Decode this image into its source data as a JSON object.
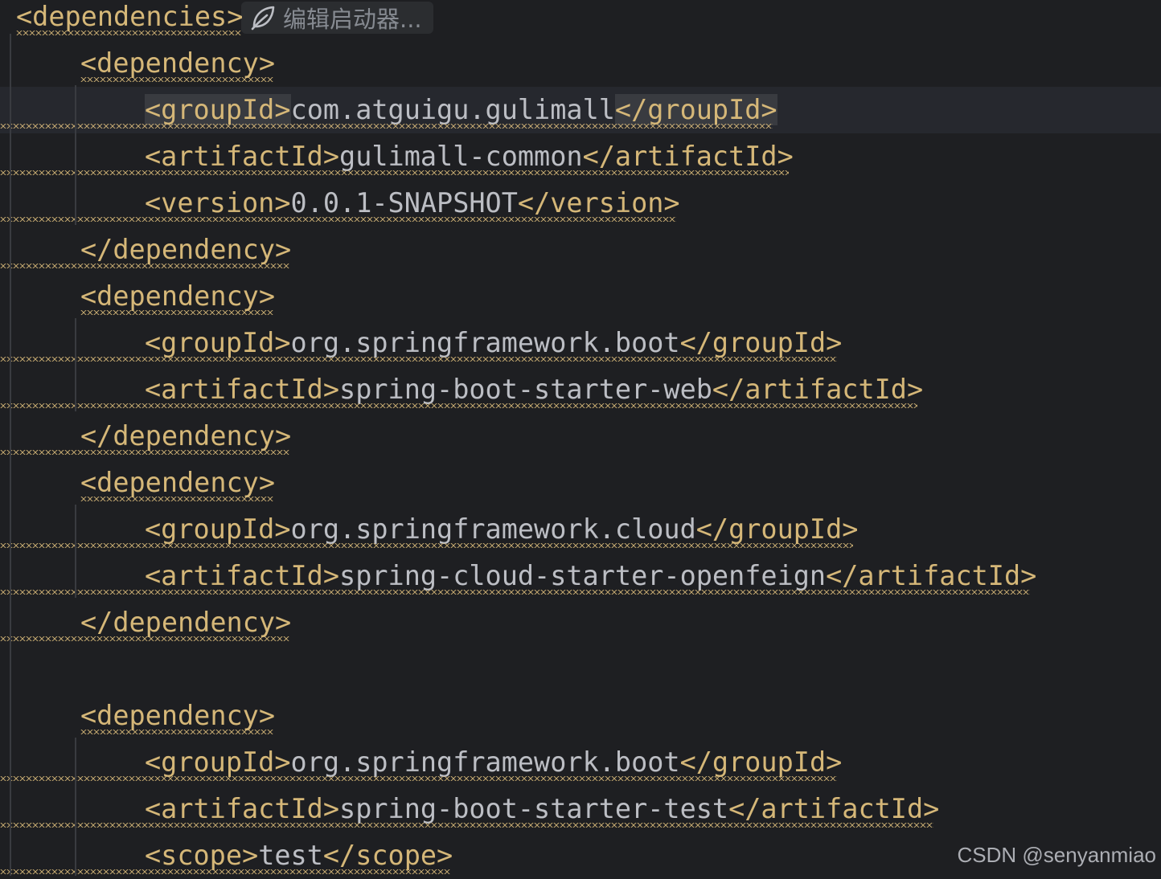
{
  "editor": {
    "hint": {
      "label": "编辑启动器...",
      "icon": "spring-leaf-icon"
    },
    "lines": [
      {
        "indent": 0,
        "open": "<dependencies>",
        "text": "",
        "close": ""
      },
      {
        "indent": 1,
        "open": "<dependency>",
        "text": "",
        "close": ""
      },
      {
        "indent": 2,
        "open": "<groupId>",
        "text": "com.atguigu.gulimall",
        "close": "</groupId>",
        "current": true
      },
      {
        "indent": 2,
        "open": "<artifactId>",
        "text": "gulimall-common",
        "close": "</artifactId>"
      },
      {
        "indent": 2,
        "open": "<version>",
        "text": "0.0.1-SNAPSHOT",
        "close": "</version>"
      },
      {
        "indent": 1,
        "open": "</dependency>",
        "text": "",
        "close": ""
      },
      {
        "indent": 1,
        "open": "<dependency>",
        "text": "",
        "close": ""
      },
      {
        "indent": 2,
        "open": "<groupId>",
        "text": "org.springframework.boot",
        "close": "</groupId>"
      },
      {
        "indent": 2,
        "open": "<artifactId>",
        "text": "spring-boot-starter-web",
        "close": "</artifactId>"
      },
      {
        "indent": 1,
        "open": "</dependency>",
        "text": "",
        "close": ""
      },
      {
        "indent": 1,
        "open": "<dependency>",
        "text": "",
        "close": ""
      },
      {
        "indent": 2,
        "open": "<groupId>",
        "text": "org.springframework.cloud",
        "close": "</groupId>"
      },
      {
        "indent": 2,
        "open": "<artifactId>",
        "text": "spring-cloud-starter-openfeign",
        "close": "</artifactId>"
      },
      {
        "indent": 1,
        "open": "</dependency>",
        "text": "",
        "close": ""
      },
      {
        "indent": 0,
        "open": "",
        "text": "",
        "close": ""
      },
      {
        "indent": 1,
        "open": "<dependency>",
        "text": "",
        "close": ""
      },
      {
        "indent": 2,
        "open": "<groupId>",
        "text": "org.springframework.boot",
        "close": "</groupId>"
      },
      {
        "indent": 2,
        "open": "<artifactId>",
        "text": "spring-boot-starter-test",
        "close": "</artifactId>"
      },
      {
        "indent": 2,
        "open": "<scope>",
        "text": "test",
        "close": "</scope>"
      }
    ]
  },
  "colors": {
    "background": "#1e1f22",
    "tag": "#d5b778",
    "text": "#bcbec4",
    "current_line": "#26282e"
  },
  "watermark": "CSDN @senyanmiao"
}
